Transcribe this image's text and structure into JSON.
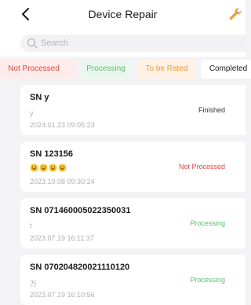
{
  "header": {
    "title": "Device Repair"
  },
  "search": {
    "placeholder": "Search"
  },
  "tabs": [
    {
      "label": "Not Processed"
    },
    {
      "label": "Processing"
    },
    {
      "label": "To be Rated"
    },
    {
      "label": "Completed"
    }
  ],
  "orders": [
    {
      "sn": "SN y",
      "desc": "y",
      "date": "2024.01.23 09:05:23",
      "status": "Finished"
    },
    {
      "sn": "SN 123156",
      "desc": "😀😀😀😀",
      "date": "2023.10.08 09:30:24",
      "status": "Not Processed"
    },
    {
      "sn": "SN 071460005022350031",
      "desc": "t",
      "date": "2023.07.19 16:11:37",
      "status": "Processing"
    },
    {
      "sn": "SN 070204820021110120",
      "desc": "万",
      "date": "2023.07.19 16:10:56",
      "status": "Processing"
    }
  ],
  "colors": {
    "finished": "#333333",
    "not_processed": "#e8433c",
    "processing": "#5bbf6e",
    "to_be_rated": "#f39a37",
    "accent_wrench": "#f39a37"
  }
}
